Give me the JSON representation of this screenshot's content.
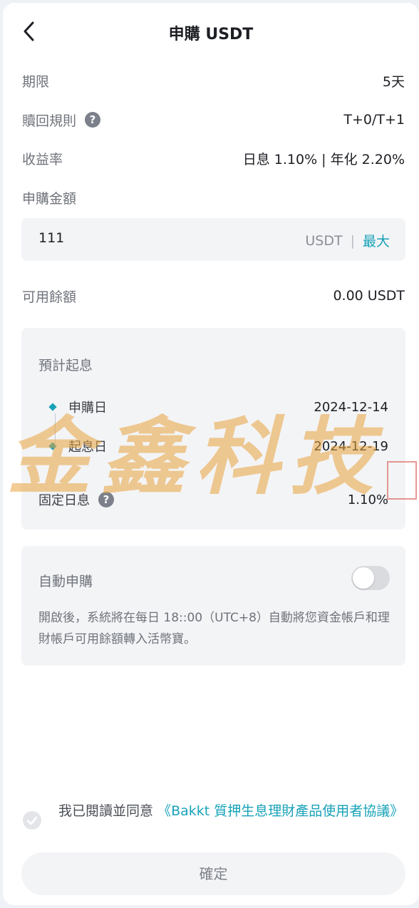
{
  "header": {
    "title": "申購 USDT"
  },
  "details": {
    "term_label": "期限",
    "term_value": "5天",
    "redeem_label": "贖回規則",
    "redeem_value": "T+0/T+1",
    "yield_label": "收益率",
    "yield_value": "日息 1.10% | 年化 2.20%",
    "amount_label": "申購金額",
    "available_label": "可用餘額",
    "available_value": "0.00 USDT"
  },
  "amount_input": {
    "value": "111",
    "unit": "USDT",
    "separator": "|",
    "max_label": "最大"
  },
  "estimate": {
    "title": "預計起息",
    "subscribe_label": "申購日",
    "subscribe_date": "2024-12-14",
    "start_label": "起息日",
    "start_date": "2024-12-19",
    "fixed_label": "固定日息",
    "fixed_value": "1.10%"
  },
  "auto": {
    "label": "自動申購",
    "enabled": false,
    "description": "開啟後，系統將在每日 18::00（UTC+8）自動將您資金帳戶和理財帳戶可用餘額轉入活幣寶。"
  },
  "agreement": {
    "text": "我已閱讀並同意",
    "link": "《Bakkt 質押生息理財產品使用者協議》",
    "checked": false
  },
  "confirm_label": "確定",
  "watermark_text": "金鑫科技",
  "colors": {
    "accent": "#17a2b8",
    "card_bg": "#f3f4f6",
    "watermark": "#e8a33d"
  }
}
